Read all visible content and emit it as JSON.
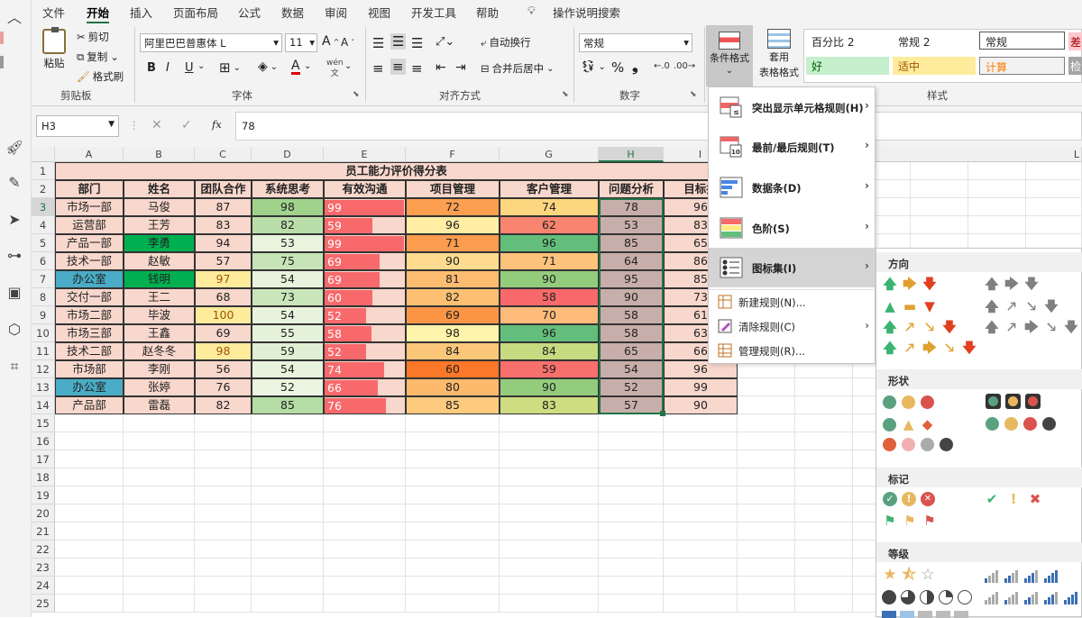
{
  "ribbon": {
    "tabs": [
      "文件",
      "开始",
      "插入",
      "页面布局",
      "公式",
      "数据",
      "审阅",
      "视图",
      "开发工具",
      "帮助"
    ],
    "active_tab": "开始",
    "tell_me": "操作说明搜索",
    "clipboard": {
      "paste": "粘贴",
      "cut": "剪切",
      "copy": "复制",
      "format_painter": "格式刷",
      "label": "剪贴板"
    },
    "font": {
      "name": "阿里巴巴普惠体 L",
      "size": "11",
      "label": "字体",
      "bold": "B",
      "italic": "I",
      "underline": "U",
      "phonetic": "wén"
    },
    "alignment": {
      "wrap": "自动换行",
      "merge": "合并后居中",
      "label": "对齐方式"
    },
    "number": {
      "format": "常规",
      "percent": "%",
      "comma": "❟",
      "label": "数字"
    },
    "styles": {
      "cond_format_line1": "条件格式",
      "table_format_line1": "套用",
      "table_format_line2": "表格格式",
      "label": "样式",
      "cells": [
        {
          "text": "百分比 2",
          "bg": "#ffffff",
          "color": "#222222"
        },
        {
          "text": "常规 2",
          "bg": "#ffffff",
          "color": "#222222"
        },
        {
          "text": "常规",
          "bg": "#ffffff",
          "color": "#222222"
        },
        {
          "text": "差",
          "bg": "#ffc7ce",
          "color": "#9c0006"
        },
        {
          "text": "好",
          "bg": "#c6efce",
          "color": "#006100"
        },
        {
          "text": "适中",
          "bg": "#ffeb9c",
          "color": "#9c5700"
        },
        {
          "text": "计算",
          "bg": "#f2f2f2",
          "color": "#fa7d00"
        },
        {
          "text": "检",
          "bg": "#a5a5a5",
          "color": "#ffffff"
        }
      ]
    }
  },
  "formula_bar": {
    "name_box": "H3",
    "fx": "fx",
    "value": "78"
  },
  "columns": [
    "A",
    "B",
    "C",
    "D",
    "E",
    "F",
    "G",
    "H",
    "I"
  ],
  "extra_column": "L",
  "row_numbers": [
    "1",
    "2",
    "3",
    "4",
    "5",
    "6",
    "7",
    "8",
    "9",
    "10",
    "11",
    "12",
    "13",
    "14",
    "15",
    "16",
    "17",
    "18",
    "19",
    "20",
    "21",
    "22",
    "23",
    "24",
    "25"
  ],
  "sheet": {
    "title": "员工能力评价得分表",
    "headers": [
      "部门",
      "姓名",
      "团队合作",
      "系统思考",
      "有效沟通",
      "项目管理",
      "客户管理",
      "问题分析",
      "目标执"
    ],
    "rows": [
      [
        "市场一部",
        "马俊",
        "87",
        "98",
        "99",
        "72",
        "74",
        "78",
        "96"
      ],
      [
        "运营部",
        "王芳",
        "83",
        "82",
        "59",
        "96",
        "62",
        "53",
        "83"
      ],
      [
        "产品一部",
        "李勇",
        "94",
        "53",
        "99",
        "71",
        "96",
        "85",
        "65"
      ],
      [
        "技术一部",
        "赵敏",
        "57",
        "75",
        "69",
        "90",
        "71",
        "64",
        "86"
      ],
      [
        "办公室",
        "钱明",
        "97",
        "54",
        "69",
        "81",
        "90",
        "95",
        "85"
      ],
      [
        "交付一部",
        "王二",
        "68",
        "73",
        "60",
        "82",
        "58",
        "90",
        "73"
      ],
      [
        "市场二部",
        "毕波",
        "100",
        "54",
        "52",
        "69",
        "70",
        "58",
        "61"
      ],
      [
        "市场三部",
        "王鑫",
        "69",
        "55",
        "58",
        "98",
        "96",
        "58",
        "63"
      ],
      [
        "技术二部",
        "赵冬冬",
        "98",
        "59",
        "52",
        "84",
        "84",
        "65",
        "66"
      ],
      [
        "市场部",
        "李刚",
        "56",
        "54",
        "74",
        "60",
        "59",
        "54",
        "96"
      ],
      [
        "办公室",
        "张婷",
        "76",
        "52",
        "66",
        "80",
        "90",
        "52",
        "99"
      ],
      [
        "产品部",
        "雷磊",
        "82",
        "85",
        "76",
        "85",
        "83",
        "57",
        "90"
      ]
    ]
  },
  "cond_menu": {
    "items": [
      {
        "label": "突出显示单元格规则(H)",
        "has_sub": true
      },
      {
        "label": "最前/最后规则(T)",
        "has_sub": true
      },
      {
        "label": "数据条(D)",
        "has_sub": true
      },
      {
        "label": "色阶(S)",
        "has_sub": true
      },
      {
        "label": "图标集(I)",
        "has_sub": true
      }
    ],
    "small_items": [
      {
        "label": "新建规则(N)...",
        "has_sub": false
      },
      {
        "label": "清除规则(C)",
        "has_sub": true
      },
      {
        "label": "管理规则(R)...",
        "has_sub": false
      }
    ]
  },
  "icon_sets": {
    "sections": [
      "方向",
      "形状",
      "标记",
      "等级"
    ]
  }
}
